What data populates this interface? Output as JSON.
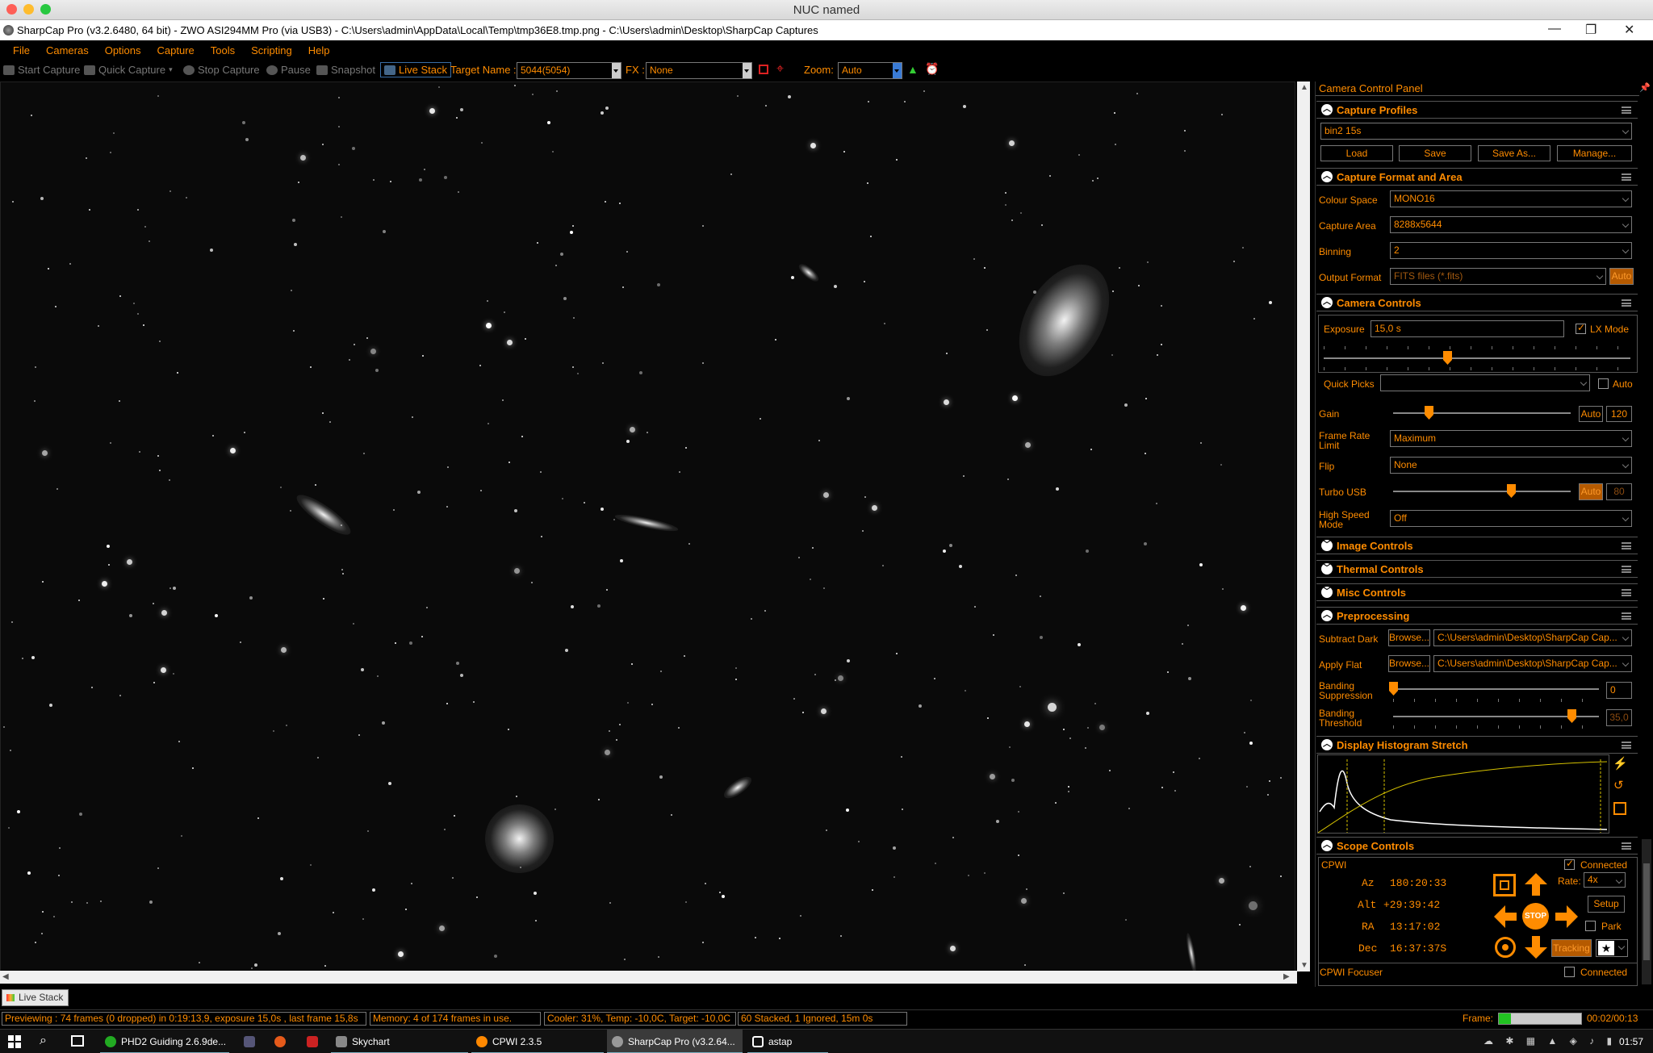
{
  "mac_window_title": "NUC named",
  "app": {
    "title": "SharpCap Pro (v3.2.6480, 64 bit) - ZWO ASI294MM Pro (via USB3) - C:\\Users\\admin\\AppData\\Local\\Temp\\tmp36E8.tmp.png - C:\\Users\\admin\\Desktop\\SharpCap Captures"
  },
  "menu": [
    "File",
    "Cameras",
    "Options",
    "Capture",
    "Tools",
    "Scripting",
    "Help"
  ],
  "toolbar": {
    "start_capture": "Start Capture",
    "quick_capture": "Quick Capture",
    "stop_capture": "Stop Capture",
    "pause": "Pause",
    "snapshot": "Snapshot",
    "live_stack": "Live Stack",
    "target_name_label": "Target Name :",
    "target_name_value": "5044(5054)",
    "fx_label": "FX :",
    "fx_value": "None",
    "zoom_label": "Zoom:",
    "zoom_value": "Auto"
  },
  "panel": {
    "title": "Camera Control Panel",
    "capture_profiles": {
      "header": "Capture Profiles",
      "profile": "bin2 15s",
      "buttons": [
        "Load",
        "Save",
        "Save As...",
        "Manage..."
      ]
    },
    "capture_format": {
      "header": "Capture Format and Area",
      "colour_space_label": "Colour Space",
      "colour_space": "MONO16",
      "capture_area_label": "Capture Area",
      "capture_area": "8288x5644",
      "binning_label": "Binning",
      "binning": "2",
      "output_format_label": "Output Format",
      "output_format": "FITS files (*.fits)",
      "auto": "Auto"
    },
    "camera_controls": {
      "header": "Camera Controls",
      "exposure_label": "Exposure",
      "exposure": "15,0 s",
      "lx_mode": "LX Mode",
      "quick_picks_label": "Quick Picks",
      "quick_picks_auto": "Auto",
      "gain_label": "Gain",
      "gain_auto": "Auto",
      "gain_value": "120",
      "frame_rate_label": "Frame Rate Limit",
      "frame_rate": "Maximum",
      "flip_label": "Flip",
      "flip": "None",
      "turbo_label": "Turbo USB",
      "turbo_auto": "Auto",
      "turbo_value": "80",
      "hsm_label": "High Speed Mode",
      "hsm": "Off"
    },
    "collapsed": [
      "Image Controls",
      "Thermal Controls",
      "Misc Controls"
    ],
    "preprocessing": {
      "header": "Preprocessing",
      "subtract_dark_label": "Subtract Dark",
      "apply_flat_label": "Apply Flat",
      "browse": "Browse...",
      "dark_path": "C:\\Users\\admin\\Desktop\\SharpCap Cap...",
      "flat_path": "C:\\Users\\admin\\Desktop\\SharpCap Cap...",
      "banding_supp_label": "Banding Suppression",
      "banding_supp_value": "0",
      "banding_thresh_label": "Banding Threshold",
      "banding_thresh_value": "35,0"
    },
    "histogram": {
      "header": "Display Histogram Stretch"
    },
    "scope": {
      "header": "Scope Controls",
      "mount": "CPWI",
      "connected": "Connected",
      "az_label": "Az",
      "az": "180:20:33",
      "alt_label": "Alt",
      "alt": "+29:39:42",
      "ra_label": "RA",
      "ra": "13:17:02",
      "dec_label": "Dec",
      "dec": "16:37:37S",
      "rate_label": "Rate:",
      "rate": "4x",
      "setup": "Setup",
      "park": "Park",
      "tracking": "Tracking",
      "stop": "STOP",
      "focuser": "CPWI Focuser",
      "focuser_connected": "Connected"
    }
  },
  "bottom": {
    "tab": "Live Stack",
    "status": [
      "Previewing : 74 frames (0 dropped) in 0:19:13,9, exposure 15,0s , last frame 15,8s",
      "Memory: 4 of 174 frames in use.",
      "Cooler: 31%, Temp: -10,0C, Target: -10,0C",
      "60 Stacked, 1 Ignored, 15m 0s"
    ],
    "frame_label": "Frame:",
    "frame_time": "00:02/00:13",
    "frame_progress": 0.15
  },
  "taskbar": {
    "items": [
      "PHD2 Guiding 2.6.9de...",
      "Skychart",
      "CPWI 2.3.5",
      "SharpCap Pro (v3.2.64...",
      "astap"
    ],
    "clock": "01:57"
  },
  "colors": {
    "accent": "#ff8c00",
    "background": "#000000"
  }
}
